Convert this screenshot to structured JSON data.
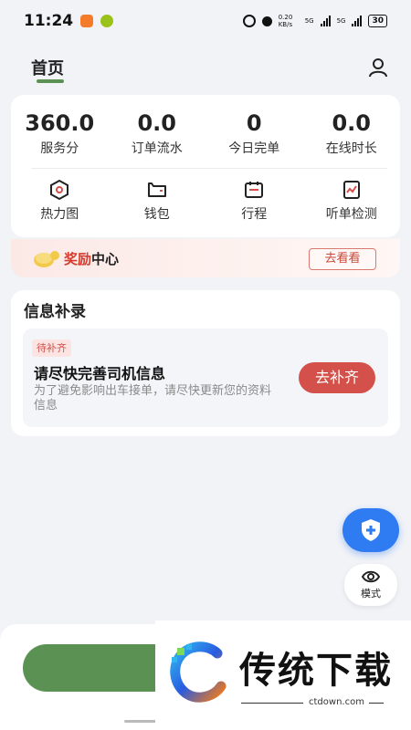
{
  "status_bar": {
    "time": "11:24",
    "net_speed": "0.20\nKB/s",
    "net1": "5G",
    "net2": "5G",
    "battery": "30"
  },
  "nav": {
    "home_tab": "首页"
  },
  "stats": [
    {
      "value": "360.0",
      "label": "服务分"
    },
    {
      "value": "0.0",
      "label": "订单流水"
    },
    {
      "value": "0",
      "label": "今日完单"
    },
    {
      "value": "0.0",
      "label": "在线时长"
    }
  ],
  "tools": [
    {
      "label": "热力图",
      "icon": "heatmap-icon"
    },
    {
      "label": "钱包",
      "icon": "wallet-icon"
    },
    {
      "label": "行程",
      "icon": "trip-icon"
    },
    {
      "label": "听单检测",
      "icon": "order-check-icon"
    }
  ],
  "reward": {
    "title_red": "奖励",
    "title_black": "中心",
    "button": "去看看"
  },
  "info": {
    "title": "信息补录",
    "tag": "待补齐",
    "task_title": "请尽快完善司机信息",
    "task_desc": "为了避免影响出车接单，请尽快更新您的资料信息",
    "button": "去补齐"
  },
  "mode_button": {
    "label": "模式"
  },
  "watermark": {
    "brand": "传统下载",
    "url": "ctdown.com"
  },
  "colors": {
    "accent_green": "#5b9254",
    "accent_red": "#d4504a",
    "fab_blue": "#2f7bf1"
  }
}
